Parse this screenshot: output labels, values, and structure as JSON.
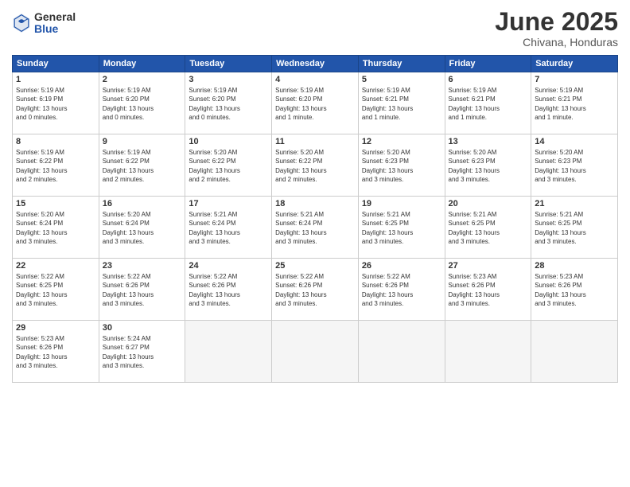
{
  "logo": {
    "general": "General",
    "blue": "Blue"
  },
  "title": "June 2025",
  "subtitle": "Chivana, Honduras",
  "days": [
    "Sunday",
    "Monday",
    "Tuesday",
    "Wednesday",
    "Thursday",
    "Friday",
    "Saturday"
  ],
  "cells": [
    {
      "day": "1",
      "sunrise": "5:19 AM",
      "sunset": "6:19 PM",
      "daylight": "13 hours and 0 minutes."
    },
    {
      "day": "2",
      "sunrise": "5:19 AM",
      "sunset": "6:20 PM",
      "daylight": "13 hours and 0 minutes."
    },
    {
      "day": "3",
      "sunrise": "5:19 AM",
      "sunset": "6:20 PM",
      "daylight": "13 hours and 0 minutes."
    },
    {
      "day": "4",
      "sunrise": "5:19 AM",
      "sunset": "6:20 PM",
      "daylight": "13 hours and 1 minute."
    },
    {
      "day": "5",
      "sunrise": "5:19 AM",
      "sunset": "6:21 PM",
      "daylight": "13 hours and 1 minute."
    },
    {
      "day": "6",
      "sunrise": "5:19 AM",
      "sunset": "6:21 PM",
      "daylight": "13 hours and 1 minute."
    },
    {
      "day": "7",
      "sunrise": "5:19 AM",
      "sunset": "6:21 PM",
      "daylight": "13 hours and 1 minute."
    },
    {
      "day": "8",
      "sunrise": "5:19 AM",
      "sunset": "6:22 PM",
      "daylight": "13 hours and 2 minutes."
    },
    {
      "day": "9",
      "sunrise": "5:19 AM",
      "sunset": "6:22 PM",
      "daylight": "13 hours and 2 minutes."
    },
    {
      "day": "10",
      "sunrise": "5:20 AM",
      "sunset": "6:22 PM",
      "daylight": "13 hours and 2 minutes."
    },
    {
      "day": "11",
      "sunrise": "5:20 AM",
      "sunset": "6:22 PM",
      "daylight": "13 hours and 2 minutes."
    },
    {
      "day": "12",
      "sunrise": "5:20 AM",
      "sunset": "6:23 PM",
      "daylight": "13 hours and 3 minutes."
    },
    {
      "day": "13",
      "sunrise": "5:20 AM",
      "sunset": "6:23 PM",
      "daylight": "13 hours and 3 minutes."
    },
    {
      "day": "14",
      "sunrise": "5:20 AM",
      "sunset": "6:23 PM",
      "daylight": "13 hours and 3 minutes."
    },
    {
      "day": "15",
      "sunrise": "5:20 AM",
      "sunset": "6:24 PM",
      "daylight": "13 hours and 3 minutes."
    },
    {
      "day": "16",
      "sunrise": "5:20 AM",
      "sunset": "6:24 PM",
      "daylight": "13 hours and 3 minutes."
    },
    {
      "day": "17",
      "sunrise": "5:21 AM",
      "sunset": "6:24 PM",
      "daylight": "13 hours and 3 minutes."
    },
    {
      "day": "18",
      "sunrise": "5:21 AM",
      "sunset": "6:24 PM",
      "daylight": "13 hours and 3 minutes."
    },
    {
      "day": "19",
      "sunrise": "5:21 AM",
      "sunset": "6:25 PM",
      "daylight": "13 hours and 3 minutes."
    },
    {
      "day": "20",
      "sunrise": "5:21 AM",
      "sunset": "6:25 PM",
      "daylight": "13 hours and 3 minutes."
    },
    {
      "day": "21",
      "sunrise": "5:21 AM",
      "sunset": "6:25 PM",
      "daylight": "13 hours and 3 minutes."
    },
    {
      "day": "22",
      "sunrise": "5:22 AM",
      "sunset": "6:25 PM",
      "daylight": "13 hours and 3 minutes."
    },
    {
      "day": "23",
      "sunrise": "5:22 AM",
      "sunset": "6:26 PM",
      "daylight": "13 hours and 3 minutes."
    },
    {
      "day": "24",
      "sunrise": "5:22 AM",
      "sunset": "6:26 PM",
      "daylight": "13 hours and 3 minutes."
    },
    {
      "day": "25",
      "sunrise": "5:22 AM",
      "sunset": "6:26 PM",
      "daylight": "13 hours and 3 minutes."
    },
    {
      "day": "26",
      "sunrise": "5:22 AM",
      "sunset": "6:26 PM",
      "daylight": "13 hours and 3 minutes."
    },
    {
      "day": "27",
      "sunrise": "5:23 AM",
      "sunset": "6:26 PM",
      "daylight": "13 hours and 3 minutes."
    },
    {
      "day": "28",
      "sunrise": "5:23 AM",
      "sunset": "6:26 PM",
      "daylight": "13 hours and 3 minutes."
    },
    {
      "day": "29",
      "sunrise": "5:23 AM",
      "sunset": "6:26 PM",
      "daylight": "13 hours and 3 minutes."
    },
    {
      "day": "30",
      "sunrise": "5:24 AM",
      "sunset": "6:27 PM",
      "daylight": "13 hours and 3 minutes."
    }
  ]
}
